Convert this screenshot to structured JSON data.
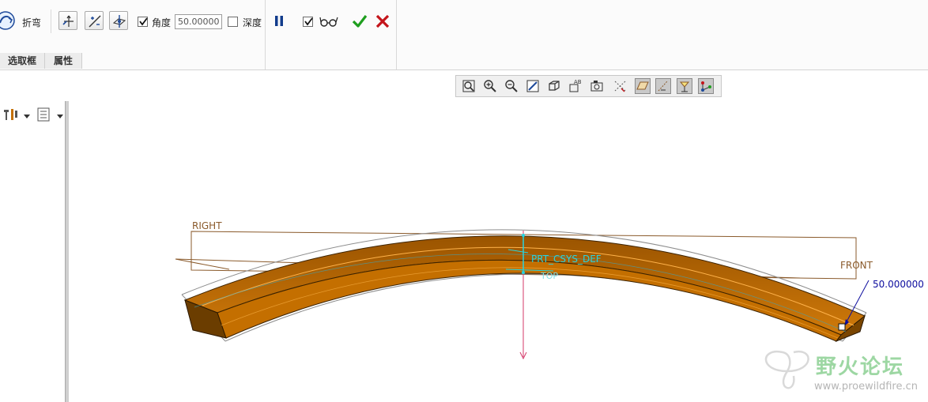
{
  "dashboard": {
    "bend_label": "折弯",
    "angle_label": "角度",
    "angle_checked": true,
    "angle_value": "50.00000",
    "depth_label": "深度",
    "depth_checked": false,
    "preview_checked": true,
    "tabs": [
      "选取框",
      "属性"
    ]
  },
  "viewport": {
    "datum_right": "RIGHT",
    "datum_front": "FRONT",
    "datum_top": "TOP",
    "csys_label": "PRT_CSYS_DEF",
    "angle_dimension": "50.000000"
  },
  "watermark": {
    "title": "野火论坛",
    "url": "www.proewildfire.cn"
  },
  "colors": {
    "part_orange": "#c46f00",
    "datum_brown": "#8a5a2b",
    "csys_cyan": "#27d3e0",
    "dimension_blue": "#0d0d9e",
    "accept_green": "#1e9e1e",
    "cancel_red": "#c4141a"
  },
  "icons": {
    "bend_tool": "bend-feature-icon",
    "toolbar": [
      "bend-direction-icon",
      "bend-reverse-icon",
      "bend-plane-icon"
    ],
    "controls": [
      "pause-icon",
      "preview-glasses-icon",
      "accept-check-icon",
      "cancel-x-icon"
    ],
    "graphics": [
      "refit-icon",
      "zoom-in-icon",
      "zoom-out-icon",
      "repaint-icon",
      "display-style-icon",
      "saved-views-icon",
      "view-manager-icon",
      "datum-display-icon",
      "plane-display-icon",
      "axis-display-icon",
      "point-display-icon",
      "csys-display-icon"
    ]
  }
}
